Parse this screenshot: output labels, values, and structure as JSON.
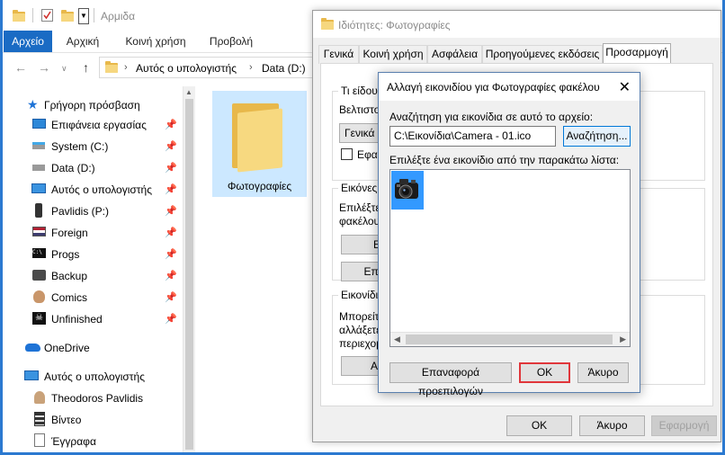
{
  "window": {
    "title": "Αρμιδα"
  },
  "ribbon": {
    "tabs": [
      "Αρχείο",
      "Αρχική",
      "Κοινή χρήση",
      "Προβολή"
    ]
  },
  "address": {
    "crumbs": [
      "Αυτός ο υπολογιστής",
      "Data (D:)"
    ]
  },
  "navpane": {
    "items": [
      {
        "label": "Γρήγορη πρόσβαση",
        "icon": "star-icon",
        "pinned": false
      },
      {
        "label": "Επιφάνεια εργασίας",
        "icon": "desktop-icon",
        "pinned": true
      },
      {
        "label": "System (C:)",
        "icon": "drive-icon",
        "pinned": true
      },
      {
        "label": "Data (D:)",
        "icon": "drive-icon",
        "pinned": true
      },
      {
        "label": "Αυτός ο υπολογιστής",
        "icon": "computer-icon",
        "pinned": true
      },
      {
        "label": "Pavlidis (P:)",
        "icon": "phone-icon",
        "pinned": true
      },
      {
        "label": "Foreign",
        "icon": "flag-icon",
        "pinned": true
      },
      {
        "label": "Progs",
        "icon": "console-icon",
        "pinned": true
      },
      {
        "label": "Backup",
        "icon": "backup-icon",
        "pinned": true
      },
      {
        "label": "Comics",
        "icon": "comics-icon",
        "pinned": true
      },
      {
        "label": "Unfinished",
        "icon": "pirate-flag-icon",
        "pinned": true
      },
      {
        "label": "OneDrive",
        "icon": "cloud-icon",
        "pinned": false
      },
      {
        "label": "Αυτός ο υπολογιστής",
        "icon": "computer-icon",
        "pinned": false
      },
      {
        "label": "Theodoros Pavlidis",
        "icon": "user-icon",
        "pinned": false
      },
      {
        "label": "Βίντεο",
        "icon": "video-icon",
        "pinned": false
      },
      {
        "label": "Έγγραφα",
        "icon": "documents-icon",
        "pinned": false
      }
    ]
  },
  "content": {
    "folder_label": "Φωτογραφίες"
  },
  "props": {
    "title": "Ιδιότητες: Φωτογραφίες",
    "tabs": [
      "Γενικά",
      "Κοινή χρήση",
      "Ασφάλεια",
      "Προηγούμενες εκδόσεις",
      "Προσαρμογή"
    ],
    "section1_label": "Τι είδους",
    "optimize_text": "Βελτιστο",
    "dropdown_value": "Γενικά σ",
    "checkbox_text": "Εφαρ",
    "section2_label": "Εικόνες φ",
    "section2_text1": "Επιλέξτε",
    "section2_text2": "φακέλου",
    "section2_btn1": "Ε",
    "section2_btn2": "Επαν",
    "section3_label": "Εικονίδιο",
    "section3_text1": "Μπορείτε",
    "section3_text2": "αλλάξετε",
    "section3_text3": "περιεχομ",
    "section3_btn": "Αλ",
    "footer": {
      "ok": "ΟΚ",
      "cancel": "Άκυρο",
      "apply": "Εφαρμογή"
    }
  },
  "change_icon": {
    "title": "Αλλαγή εικονιδίου για Φωτογραφίες φακέλου",
    "search_label": "Αναζήτηση για εικονίδια σε αυτό το αρχείο:",
    "path_value": "C:\\Εικονίδια\\Camera - 01.ico",
    "browse_label": "Αναζήτηση...",
    "list_label": "Επιλέξτε ένα εικονίδιο από την παρακάτω λίστα:",
    "restore_label": "Επαναφορά προεπιλογών",
    "ok_label": "ΟΚ",
    "cancel_label": "Άκυρο"
  }
}
